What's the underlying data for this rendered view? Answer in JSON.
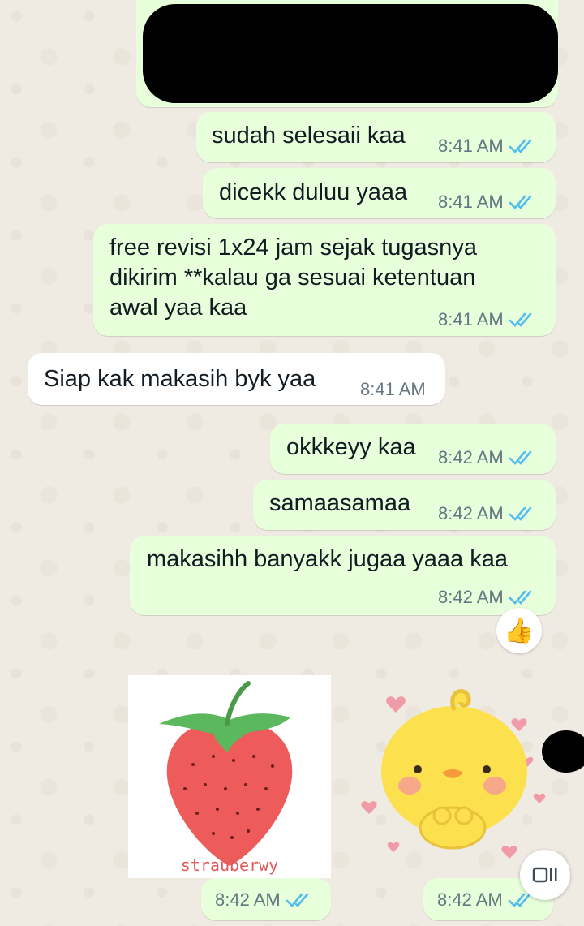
{
  "colors": {
    "outgoing_bubble": "#e7ffdb",
    "incoming_bubble": "#ffffff",
    "read_ticks": "#53bdeb",
    "background": "#efeae2"
  },
  "messages": [
    {
      "text": "sudah selesaii kaa",
      "time": "8:41 AM",
      "direction": "out",
      "status": "read"
    },
    {
      "text": "dicekk duluu yaaa",
      "time": "8:41 AM",
      "direction": "out",
      "status": "read"
    },
    {
      "text": "free revisi 1x24 jam sejak tugasnya\ndikirim **kalau ga sesuai ketentuan\nawal yaa kaa",
      "time": "8:41 AM",
      "direction": "out",
      "status": "read"
    },
    {
      "text": "Siap kak makasih byk yaa",
      "time": "8:41 AM",
      "direction": "in"
    },
    {
      "text": "okkkeyy kaa",
      "time": "8:42 AM",
      "direction": "out",
      "status": "read"
    },
    {
      "text": "samaasamaa",
      "time": "8:42 AM",
      "direction": "out",
      "status": "read"
    },
    {
      "text": "makasihh banyakk jugaa yaaa kaa",
      "time": "8:42 AM",
      "direction": "out",
      "status": "read",
      "reaction": "thumbs-up"
    }
  ],
  "stickers": [
    {
      "name": "strawberry-sticker",
      "caption": "strauberwy",
      "time": "8:42 AM",
      "status": "read"
    },
    {
      "name": "duck-sticker",
      "time": "8:42 AM",
      "status": "read"
    }
  ],
  "icons": {
    "reaction": "thumbs-up-icon",
    "float_button": "view-once-icon"
  }
}
